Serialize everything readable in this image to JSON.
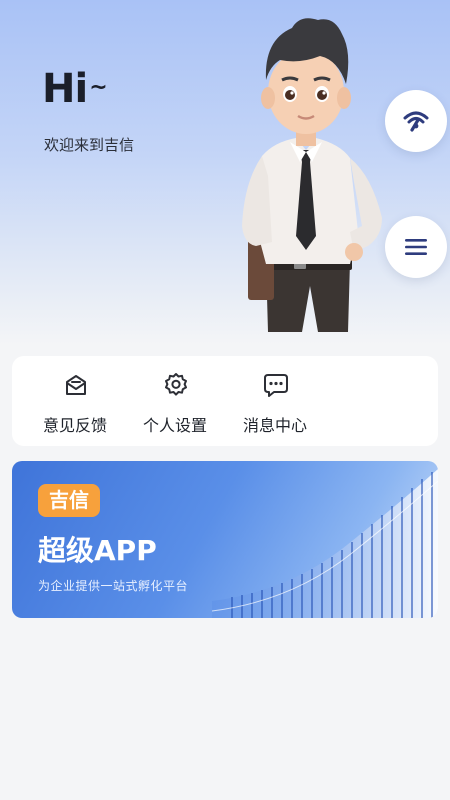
{
  "header": {
    "greeting": "Hi",
    "greeting_suffix": "~",
    "welcome": "欢迎来到吉信"
  },
  "side_buttons": [
    {
      "icon": "signal-icon"
    },
    {
      "icon": "menu-icon"
    }
  ],
  "quick_actions": [
    {
      "label": "意见反馈",
      "icon": "feedback-mail-icon"
    },
    {
      "label": "个人设置",
      "icon": "gear-icon"
    },
    {
      "label": "消息中心",
      "icon": "message-bubble-icon"
    }
  ],
  "banner": {
    "badge": "吉信",
    "title": "超级APP",
    "subtitle": "为企业提供一站式孵化平台"
  },
  "colors": {
    "accent": "#2e3c7e",
    "badge": "#f7a13c",
    "banner": "#3f74d9"
  }
}
